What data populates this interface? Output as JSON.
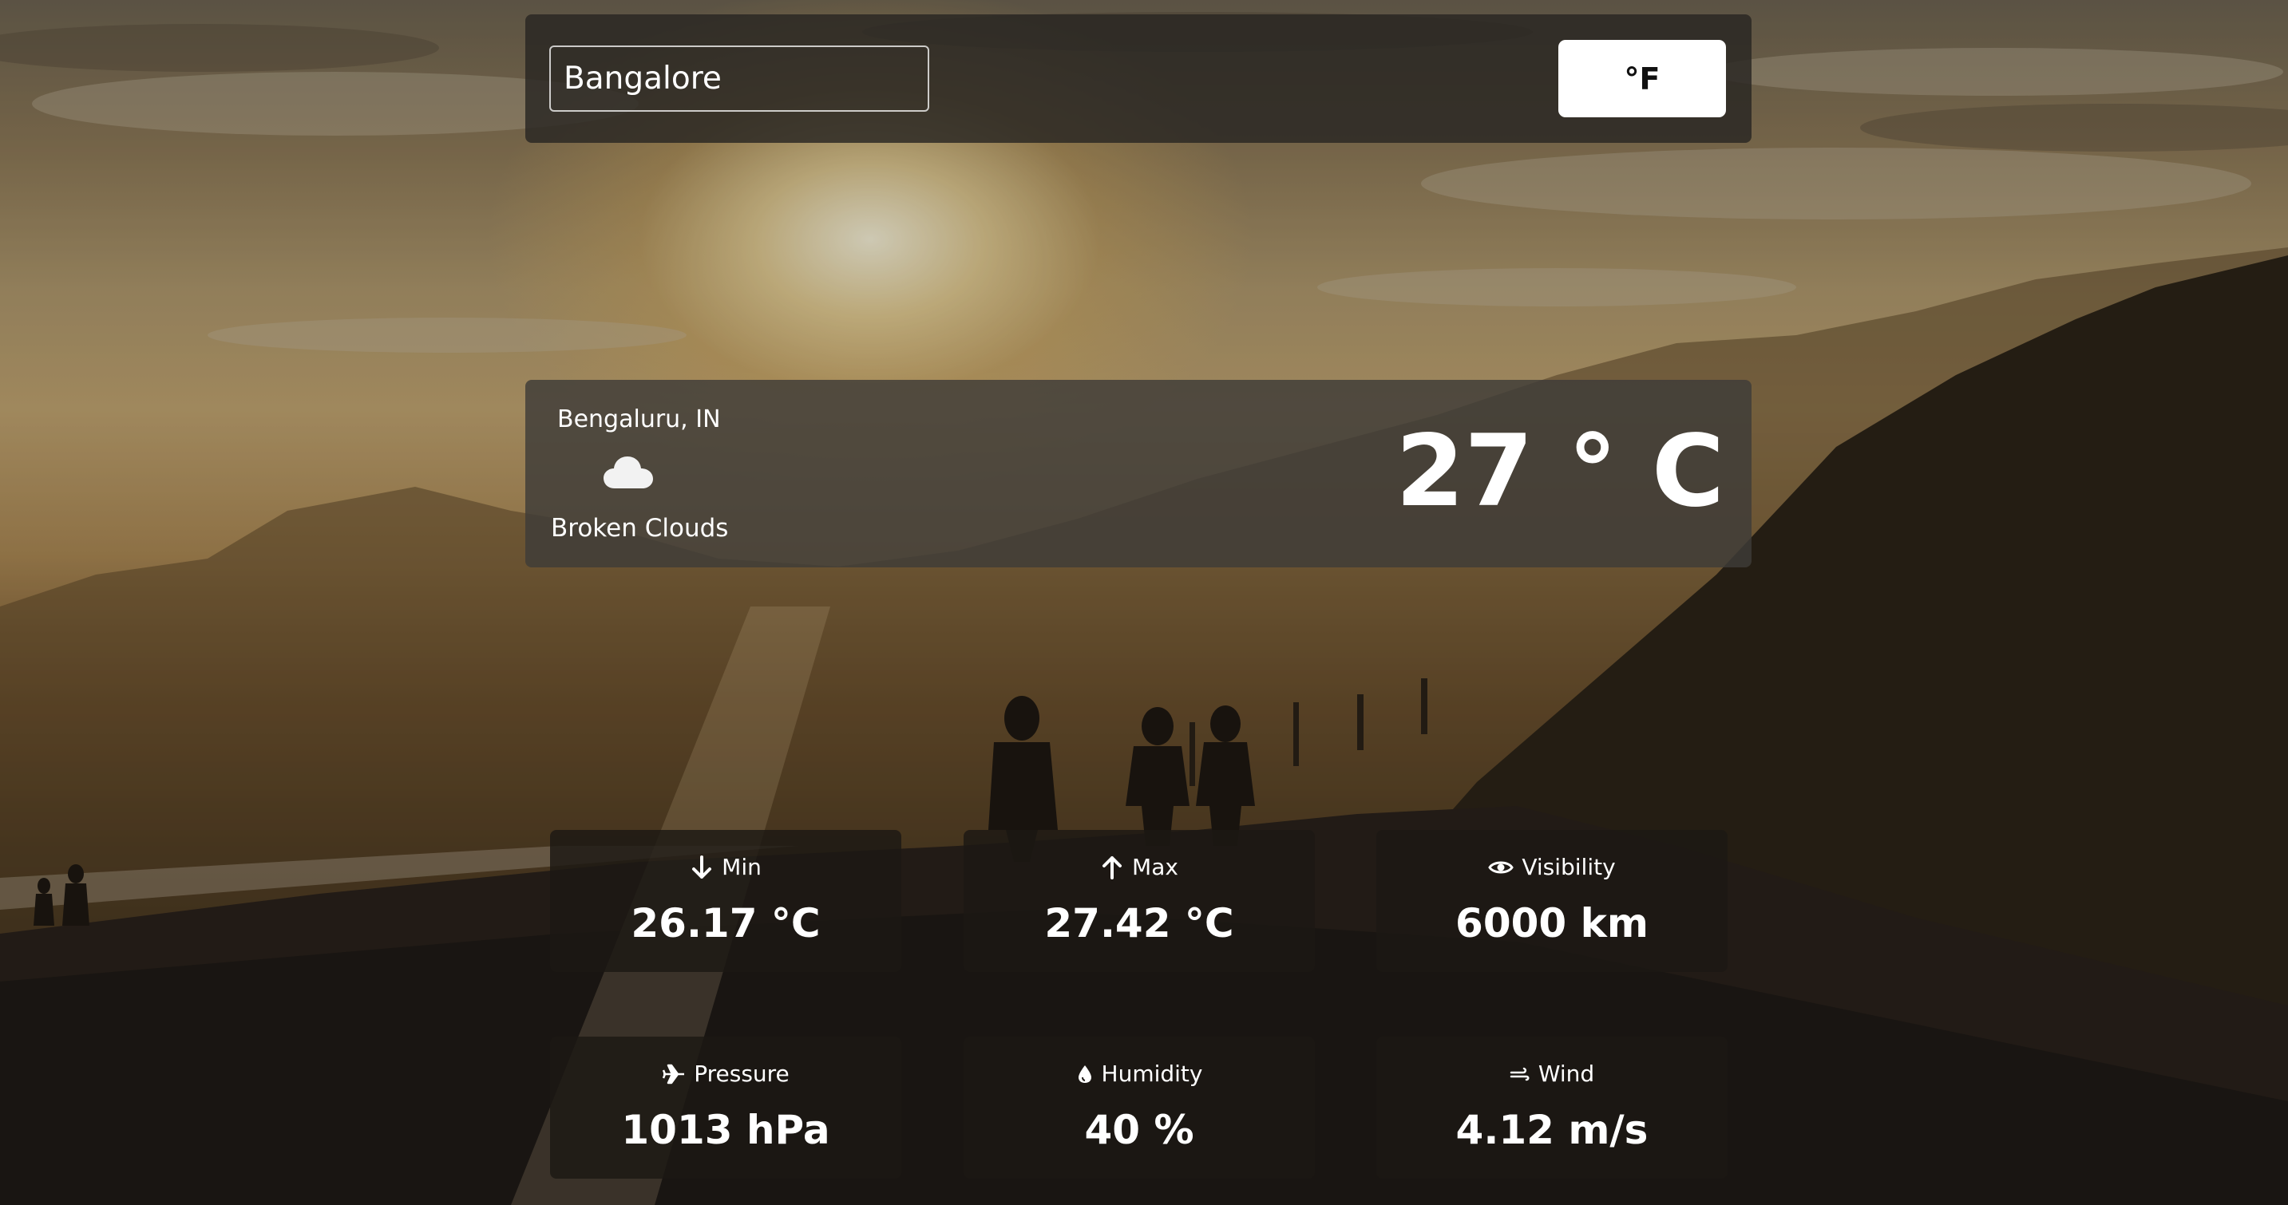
{
  "search": {
    "value": "Bangalore"
  },
  "unit_toggle": {
    "label": "°F"
  },
  "current": {
    "location": "Bengaluru, IN",
    "condition": "Broken Clouds",
    "icon": "cloud-icon",
    "temperature": "27 ° C"
  },
  "stats": {
    "min": {
      "label": "Min",
      "value": "26.17 °C",
      "icon": "arrow-down-icon"
    },
    "max": {
      "label": "Max",
      "value": "27.42 °C",
      "icon": "arrow-up-icon"
    },
    "visibility": {
      "label": "Visibility",
      "value": "6000 km",
      "icon": "eye-icon"
    },
    "pressure": {
      "label": "Pressure",
      "value": "1013 hPa",
      "icon": "plane-icon"
    },
    "humidity": {
      "label": "Humidity",
      "value": "40 %",
      "icon": "droplet-icon"
    },
    "wind": {
      "label": "Wind",
      "value": "4.12 m/s",
      "icon": "wind-icon"
    }
  },
  "colors": {
    "panel": "#3e3c38",
    "card": "#1c1814",
    "button": "#ffffff",
    "text": "#ffffff"
  }
}
